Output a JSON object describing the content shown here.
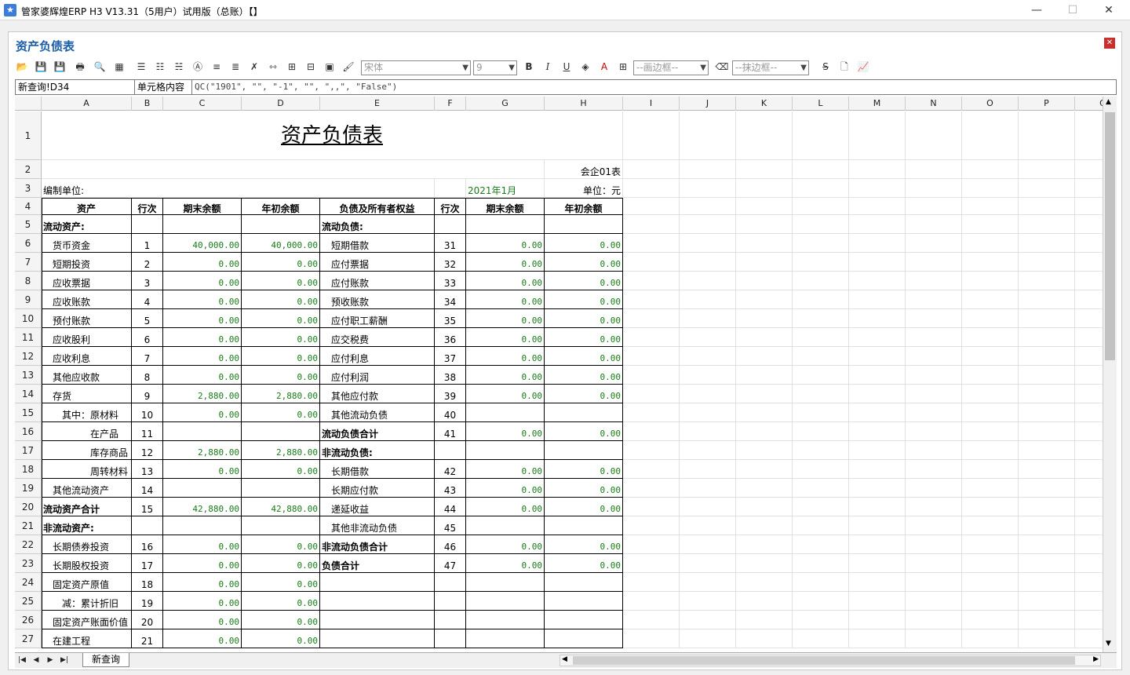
{
  "window": {
    "title": "管家婆辉煌ERP H3 V13.31（5用户）试用版（总账）【】",
    "minimize": "—",
    "maximize": "☐",
    "close": "✕"
  },
  "panel": {
    "title": "资产负债表",
    "close": "✕"
  },
  "toolbar": {
    "font_name": "宋体",
    "font_size": "9",
    "bold": "B",
    "italic": "I",
    "underline": "U",
    "draw_border": "--画边框--",
    "erase_border": "--抹边框--"
  },
  "formula_bar": {
    "cell_ref": "新查询!D34",
    "label": "单元格内容",
    "content": "QC(\"1901\", \"\", \"-1\", \"\", \",,\", \"False\")"
  },
  "columns": [
    "A",
    "B",
    "C",
    "D",
    "E",
    "F",
    "G",
    "H",
    "I",
    "J",
    "K",
    "L",
    "M",
    "N",
    "O",
    "P",
    "Q"
  ],
  "sheet": {
    "tab": "新查询"
  },
  "report": {
    "title": "资产负债表",
    "form_no": "会企01表",
    "company_label": "编制单位:",
    "period": "2021年1月",
    "unit": "单位：元",
    "headers": [
      "资产",
      "行次",
      "期末余额",
      "年初余额",
      "负债及所有者权益",
      "行次",
      "期末余额",
      "年初余额"
    ],
    "rows": [
      [
        "流动资产:",
        "",
        "",
        "",
        "流动负债:",
        "",
        "",
        ""
      ],
      [
        "货币资金",
        "1",
        "40,000.00",
        "40,000.00",
        "短期借款",
        "31",
        "0.00",
        "0.00"
      ],
      [
        "短期投资",
        "2",
        "0.00",
        "0.00",
        "应付票据",
        "32",
        "0.00",
        "0.00"
      ],
      [
        "应收票据",
        "3",
        "0.00",
        "0.00",
        "应付账款",
        "33",
        "0.00",
        "0.00"
      ],
      [
        "应收账款",
        "4",
        "0.00",
        "0.00",
        "预收账款",
        "34",
        "0.00",
        "0.00"
      ],
      [
        "预付账款",
        "5",
        "0.00",
        "0.00",
        "应付职工薪酬",
        "35",
        "0.00",
        "0.00"
      ],
      [
        "应收股利",
        "6",
        "0.00",
        "0.00",
        "应交税费",
        "36",
        "0.00",
        "0.00"
      ],
      [
        "应收利息",
        "7",
        "0.00",
        "0.00",
        "应付利息",
        "37",
        "0.00",
        "0.00"
      ],
      [
        "其他应收款",
        "8",
        "0.00",
        "0.00",
        "应付利润",
        "38",
        "0.00",
        "0.00"
      ],
      [
        "存货",
        "9",
        "2,880.00",
        "2,880.00",
        "其他应付款",
        "39",
        "0.00",
        "0.00"
      ],
      [
        "其中：原材料",
        "10",
        "0.00",
        "0.00",
        "其他流动负债",
        "40",
        "",
        ""
      ],
      [
        "在产品",
        "11",
        "",
        "",
        "流动负债合计",
        "41",
        "0.00",
        "0.00"
      ],
      [
        "库存商品",
        "12",
        "2,880.00",
        "2,880.00",
        "非流动负债:",
        "",
        "",
        ""
      ],
      [
        "周转材料",
        "13",
        "0.00",
        "0.00",
        "长期借款",
        "42",
        "0.00",
        "0.00"
      ],
      [
        "其他流动资产",
        "14",
        "",
        "",
        "长期应付款",
        "43",
        "0.00",
        "0.00"
      ],
      [
        "流动资产合计",
        "15",
        "42,880.00",
        "42,880.00",
        "递延收益",
        "44",
        "0.00",
        "0.00"
      ],
      [
        "非流动资产:",
        "",
        "",
        "",
        "其他非流动负债",
        "45",
        "",
        ""
      ],
      [
        "长期债券投资",
        "16",
        "0.00",
        "0.00",
        "非流动负债合计",
        "46",
        "0.00",
        "0.00"
      ],
      [
        "长期股权投资",
        "17",
        "0.00",
        "0.00",
        "负债合计",
        "47",
        "0.00",
        "0.00"
      ],
      [
        "固定资产原值",
        "18",
        "0.00",
        "0.00",
        "",
        "",
        "",
        ""
      ],
      [
        "减：累计折旧",
        "19",
        "0.00",
        "0.00",
        "",
        "",
        "",
        ""
      ],
      [
        "固定资产账面价值",
        "20",
        "0.00",
        "0.00",
        "",
        "",
        "",
        ""
      ],
      [
        "在建工程",
        "21",
        "0.00",
        "0.00",
        "",
        "",
        "",
        ""
      ]
    ]
  }
}
